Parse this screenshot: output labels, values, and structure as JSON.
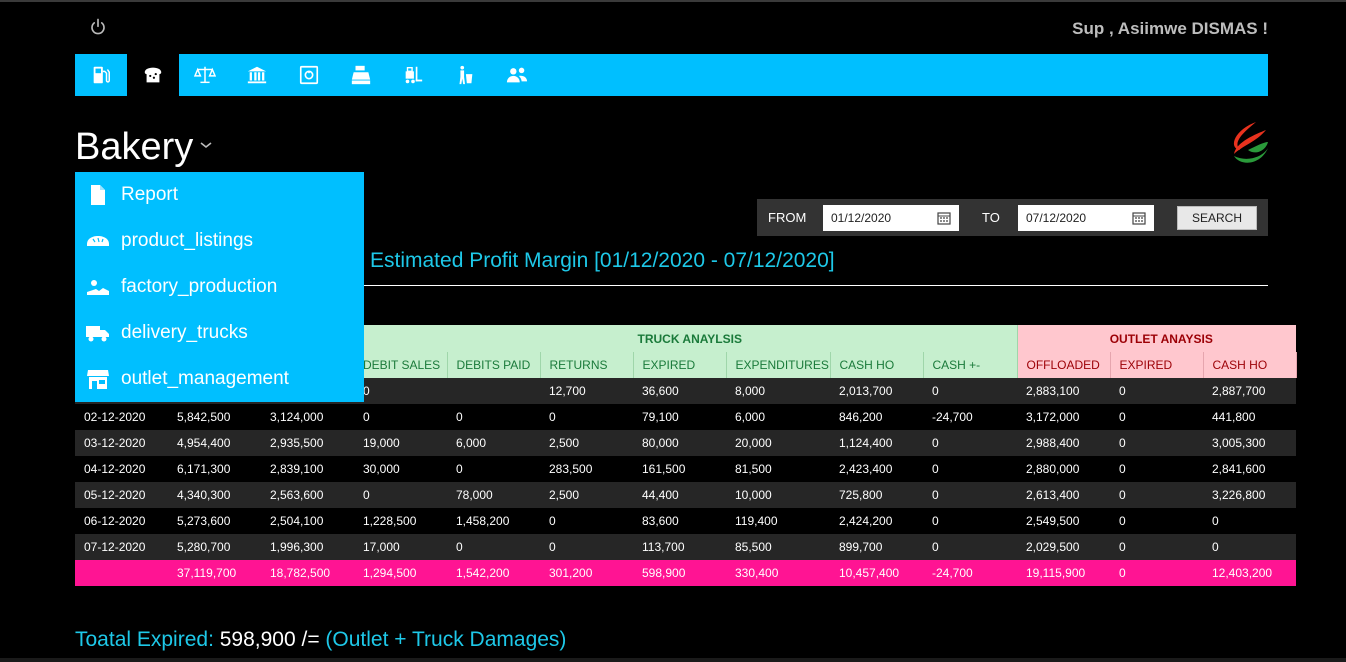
{
  "header": {
    "greeting": "Sup , Asiimwe DISMAS !"
  },
  "nav": {
    "items": [
      {
        "name": "fuel-pump-icon"
      },
      {
        "name": "bread-icon",
        "active": true
      },
      {
        "name": "scales-icon"
      },
      {
        "name": "bank-icon"
      },
      {
        "name": "safe-icon"
      },
      {
        "name": "cash-register-icon"
      },
      {
        "name": "forklift-icon"
      },
      {
        "name": "trash-person-icon"
      },
      {
        "name": "users-icon"
      }
    ],
    "accent": "#00bfff"
  },
  "page": {
    "title": "Bakery"
  },
  "menu": {
    "items": [
      {
        "label": "Report",
        "icon": "file-icon"
      },
      {
        "label": "product_listings",
        "icon": "bread-loaf-icon"
      },
      {
        "label": "factory_production",
        "icon": "factory-icon"
      },
      {
        "label": "delivery_trucks",
        "icon": "truck-icon"
      },
      {
        "label": "outlet_management",
        "icon": "store-icon"
      }
    ]
  },
  "filter": {
    "from_label": "FROM",
    "from_value": "01/12/2020",
    "to_label": "TO",
    "to_value": "07/12/2020",
    "search_label": "SEARCH"
  },
  "subtitle": "Estimated Profit Margin [01/12/2020 - 07/12/2020]",
  "table": {
    "truck_group": "TRUCK ANAYLSIS",
    "outlet_group": "OUTLET ANAYSIS",
    "truck_headers": [
      "DEBIT SALES",
      "DEBITS PAID",
      "RETURNS",
      "EXPIRED",
      "EXPENDITURES",
      "CASH HO",
      "CASH +-"
    ],
    "outlet_headers": [
      "OFFLOADED",
      "EXPIRED",
      "CASH HO"
    ],
    "rows": [
      [
        "",
        "",
        "",
        "0",
        "",
        "12,700",
        "36,600",
        "8,000",
        "2,013,700",
        "0",
        "2,883,100",
        "0",
        "2,887,700"
      ],
      [
        "02-12-2020",
        "5,842,500",
        "3,124,000",
        "0",
        "0",
        "0",
        "79,100",
        "6,000",
        "846,200",
        "-24,700",
        "3,172,000",
        "0",
        "441,800"
      ],
      [
        "03-12-2020",
        "4,954,400",
        "2,935,500",
        "19,000",
        "6,000",
        "2,500",
        "80,000",
        "20,000",
        "1,124,400",
        "0",
        "2,988,400",
        "0",
        "3,005,300"
      ],
      [
        "04-12-2020",
        "6,171,300",
        "2,839,100",
        "30,000",
        "0",
        "283,500",
        "161,500",
        "81,500",
        "2,423,400",
        "0",
        "2,880,000",
        "0",
        "2,841,600"
      ],
      [
        "05-12-2020",
        "4,340,300",
        "2,563,600",
        "0",
        "78,000",
        "2,500",
        "44,400",
        "10,000",
        "725,800",
        "0",
        "2,613,400",
        "0",
        "3,226,800"
      ],
      [
        "06-12-2020",
        "5,273,600",
        "2,504,100",
        "1,228,500",
        "1,458,200",
        "0",
        "83,600",
        "119,400",
        "2,424,200",
        "0",
        "2,549,500",
        "0",
        "0"
      ],
      [
        "07-12-2020",
        "5,280,700",
        "1,996,300",
        "17,000",
        "0",
        "0",
        "113,700",
        "85,500",
        "899,700",
        "0",
        "2,029,500",
        "0",
        "0"
      ]
    ],
    "total": [
      "",
      "37,119,700",
      "18,782,500",
      "1,294,500",
      "1,542,200",
      "301,200",
      "598,900",
      "330,400",
      "10,457,400",
      "-24,700",
      "19,115,900",
      "0",
      "12,403,200"
    ]
  },
  "footer": {
    "prefix": "Toatal Expired: ",
    "value": "598,900 /=",
    "suffix": " (Outlet + Truck Damages)"
  }
}
